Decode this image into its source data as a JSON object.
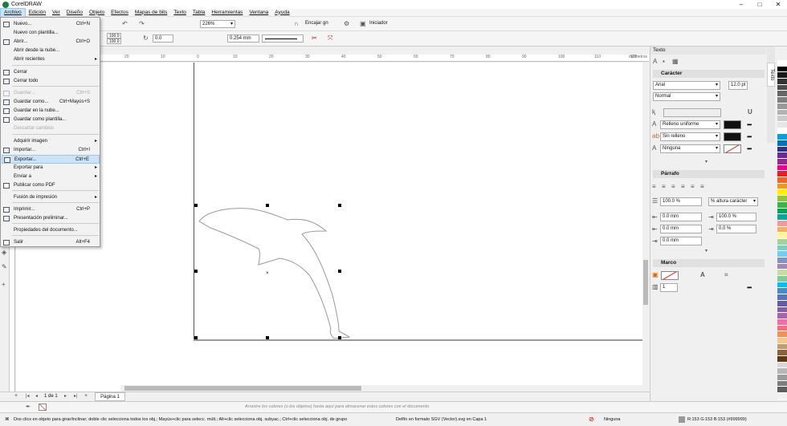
{
  "app": {
    "title": "CorelDRAW"
  },
  "menubar": [
    "Archivo",
    "Edición",
    "Ver",
    "Diseño",
    "Objeto",
    "Efectos",
    "Mapas de bits",
    "Texto",
    "Tabla",
    "Herramientas",
    "Ventana",
    "Ayuda"
  ],
  "toolbar": {
    "zoom": "226%",
    "snap": "Encajar gn",
    "launcher": "Iniciador",
    "size_w": "100.0",
    "size_h": "100.0",
    "angle": "0.0",
    "outline_width": "0.254 mm"
  },
  "file_menu": {
    "items": [
      {
        "label": "Nuevo...",
        "shortcut": "Ctrl+N",
        "state": "normal",
        "icon": "new-doc-icon"
      },
      {
        "label": "Nuevo con plantilla...",
        "shortcut": "",
        "state": "normal",
        "icon": ""
      },
      {
        "label": "Abrir...",
        "shortcut": "Ctrl+O",
        "state": "normal",
        "icon": "open-folder-icon"
      },
      {
        "label": "Abrir desde la nube...",
        "shortcut": "",
        "state": "normal",
        "icon": ""
      },
      {
        "label": "Abrir recientes",
        "shortcut": "",
        "state": "submenu",
        "icon": ""
      },
      {
        "label": "Cerrar",
        "shortcut": "",
        "state": "normal",
        "icon": "close-doc-icon"
      },
      {
        "label": "Cerrar todo",
        "shortcut": "",
        "state": "normal",
        "icon": "close-all-icon"
      },
      {
        "label": "Guardar...",
        "shortcut": "Ctrl+S",
        "state": "disabled",
        "icon": "save-icon"
      },
      {
        "label": "Guardar como...",
        "shortcut": "Ctrl+Mayús+S",
        "state": "normal",
        "icon": "save-as-icon"
      },
      {
        "label": "Guardar en la nube...",
        "shortcut": "",
        "state": "normal",
        "icon": "cloud-save-icon"
      },
      {
        "label": "Guardar como plantilla...",
        "shortcut": "",
        "state": "normal",
        "icon": "template-save-icon"
      },
      {
        "label": "Descartar cambios",
        "shortcut": "",
        "state": "disabled",
        "icon": ""
      },
      {
        "label": "Adquirir imagen",
        "shortcut": "",
        "state": "submenu",
        "icon": ""
      },
      {
        "label": "Importar...",
        "shortcut": "Ctrl+I",
        "state": "normal",
        "icon": "import-icon"
      },
      {
        "label": "Exportar...",
        "shortcut": "Ctrl+E",
        "state": "highlighted",
        "icon": "export-icon"
      },
      {
        "label": "Exportar para",
        "shortcut": "",
        "state": "submenu",
        "icon": ""
      },
      {
        "label": "Enviar a",
        "shortcut": "",
        "state": "submenu",
        "icon": ""
      },
      {
        "label": "Publicar como PDF",
        "shortcut": "",
        "state": "normal",
        "icon": "pdf-icon"
      },
      {
        "label": "Fusión de impresión",
        "shortcut": "",
        "state": "submenu",
        "icon": ""
      },
      {
        "label": "Imprimir...",
        "shortcut": "Ctrl+P",
        "state": "normal",
        "icon": "print-icon"
      },
      {
        "label": "Presentación preliminar...",
        "shortcut": "",
        "state": "normal",
        "icon": "print-preview-icon"
      },
      {
        "label": "Propiedades del documento...",
        "shortcut": "",
        "state": "normal",
        "icon": ""
      },
      {
        "label": "Salir",
        "shortcut": "Alt+F4",
        "state": "normal",
        "icon": "exit-icon"
      }
    ]
  },
  "ruler": {
    "ticks": [
      "20",
      "10",
      "0",
      "10",
      "20",
      "30",
      "40",
      "50",
      "60",
      "70",
      "80",
      "90",
      "100",
      "110",
      "120"
    ],
    "unit": "milímetros"
  },
  "docker": {
    "title": "Texto",
    "character": {
      "header": "Carácter",
      "font": "Arial",
      "size": "12.0 pt",
      "style": "Normal",
      "fill_type": "Relleno uniforme",
      "bg_fill": "Sin relleno",
      "outline": "Ninguna"
    },
    "paragraph": {
      "header": "Párrafo",
      "line_spacing": "100.0 %",
      "line_unit": "% altura carácter",
      "indent_left": "0.0 mm",
      "indent_first": "0.0 mm",
      "indent_right": "0.0 mm",
      "char_spacing": "100.0 %",
      "word_spacing": "0.0 %"
    },
    "frame": {
      "header": "Marco",
      "columns": "1"
    }
  },
  "side_tabs": [
    "Texto"
  ],
  "pages": {
    "counter": "1 de 1",
    "tab": "Página 1"
  },
  "color_hint": "Arrastre los colores (o los objetos) hasta aquí para almacenar estos colores con el documento",
  "status": {
    "hint": "Dos clics en objeto para girar/inclinar; doble clic selecciona todos los obj.; Mayús+clic para selecc. múlt.; Alt+clic selecciona obj. subyac.; Ctrl+clic selecciona obj. de grupo",
    "object": "Delfín en formato SGV (Vector).svg en Capa 1",
    "fill": "Ninguna",
    "outline_color": "R:153 G:153 B:153 (#999999)"
  },
  "palette_colors": [
    "#ffffff",
    "#000000",
    "#1a1a1a",
    "#333333",
    "#4d4d4d",
    "#666666",
    "#808080",
    "#999999",
    "#b3b3b3",
    "#cccccc",
    "#e6e6e6",
    "#ffffff",
    "#00a0e3",
    "#0072bc",
    "#2e3192",
    "#662d91",
    "#92278f",
    "#ec008c",
    "#ed1c24",
    "#f26522",
    "#f7941d",
    "#fff200",
    "#8dc63f",
    "#39b54a",
    "#00a651",
    "#00a99d",
    "#f5989d",
    "#fbaf5d",
    "#fff799",
    "#a3d39c",
    "#7accc8",
    "#6dcff6",
    "#8393ca",
    "#a186be",
    "#c4df9b",
    "#82ca9c",
    "#00bff3",
    "#448ccb",
    "#5674b9",
    "#605ca8",
    "#855fa8",
    "#a864a8",
    "#f06eaa",
    "#f26d7d",
    "#f68e56",
    "#fdc689",
    "#c69c6d",
    "#8c6239",
    "#603913",
    "#d7d7d7",
    "#b7b7b7",
    "#9a9a9a",
    "#7d7d7d",
    "#5e5e5e",
    "#f0f0f0"
  ]
}
